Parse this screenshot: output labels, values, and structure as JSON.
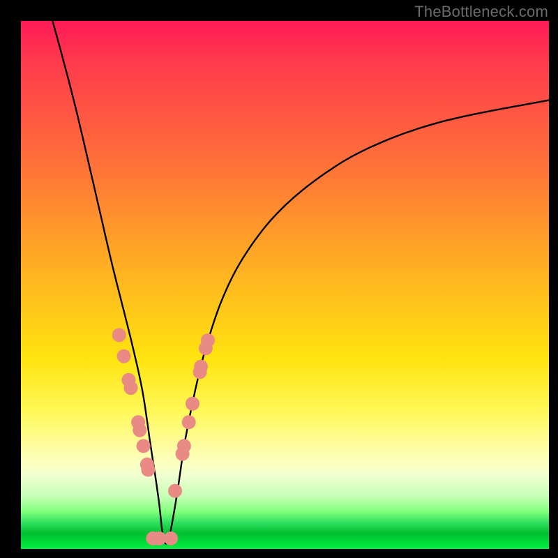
{
  "watermark": "TheBottleneck.com",
  "colors": {
    "dot": "#e98b84",
    "curve": "#000000",
    "frame": "#000000"
  },
  "chart_data": {
    "type": "line",
    "title": "",
    "xlabel": "",
    "ylabel": "",
    "xlim": [
      0,
      100
    ],
    "ylim": [
      0,
      100
    ],
    "notes": "V-shaped bottleneck curve with minimum near x≈27; y interpreted as bottleneck percentage (top=100, bottom=0). Values estimated from pixel positions.",
    "series": [
      {
        "name": "bottleneck-curve",
        "x": [
          6,
          10,
          14,
          17,
          19,
          21,
          23,
          24.5,
          26,
          27,
          28,
          29.5,
          31,
          33,
          35,
          38,
          42,
          48,
          56,
          66,
          80,
          100
        ],
        "y": [
          100,
          85,
          68,
          55,
          47,
          39,
          30,
          20,
          10,
          2,
          2,
          10,
          20,
          30,
          38,
          47,
          55,
          63,
          70,
          76,
          81,
          85
        ]
      }
    ],
    "markers": {
      "name": "highlight-dots",
      "x": [
        18.6,
        19.5,
        20.4,
        20.8,
        22.2,
        22.5,
        23.2,
        23.9,
        24.1,
        25.0,
        26.2,
        28.4,
        29.2,
        30.6,
        30.9,
        31.8,
        32.5,
        33.9,
        34.1,
        35.0,
        35.4
      ],
      "y": [
        40.5,
        36.5,
        32.0,
        30.5,
        24.0,
        22.5,
        19.5,
        16.0,
        15.0,
        2.0,
        2.0,
        2.0,
        11.0,
        18.0,
        19.5,
        24.0,
        27.5,
        33.5,
        34.5,
        38.0,
        39.5
      ]
    }
  }
}
